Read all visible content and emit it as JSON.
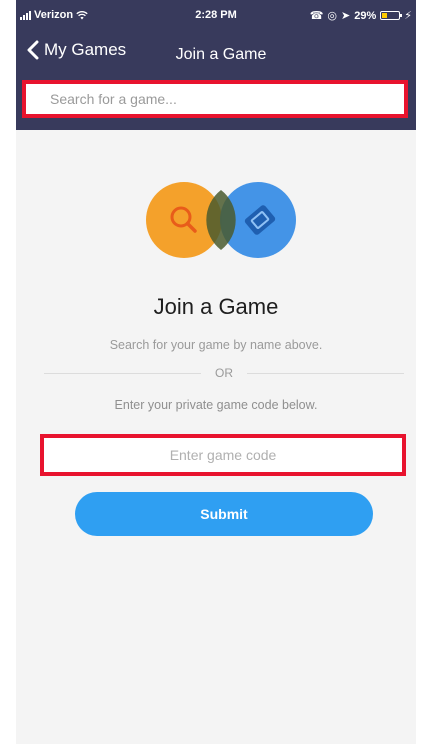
{
  "status_bar": {
    "carrier": "Verizon",
    "time": "2:28 PM",
    "battery_percent": "29%",
    "battery_level": 0.29
  },
  "nav": {
    "back_label": "My Games",
    "title": "Join a Game"
  },
  "search": {
    "placeholder": "Search for a game..."
  },
  "hero": {
    "icons": [
      "search-icon",
      "ticket-icon"
    ],
    "colors": {
      "left_circle": "#f4a12b",
      "right_circle": "#3a8ee6"
    }
  },
  "content": {
    "title": "Join a Game",
    "subtitle": "Search for your game by name above.",
    "or_label": "OR",
    "code_hint": "Enter your private game code below."
  },
  "code": {
    "placeholder": "Enter game code"
  },
  "submit": {
    "label": "Submit"
  },
  "colors": {
    "header": "#383a5c",
    "highlight": "#e8132e",
    "button": "#2f9ff2",
    "background": "#f4f4f4"
  }
}
